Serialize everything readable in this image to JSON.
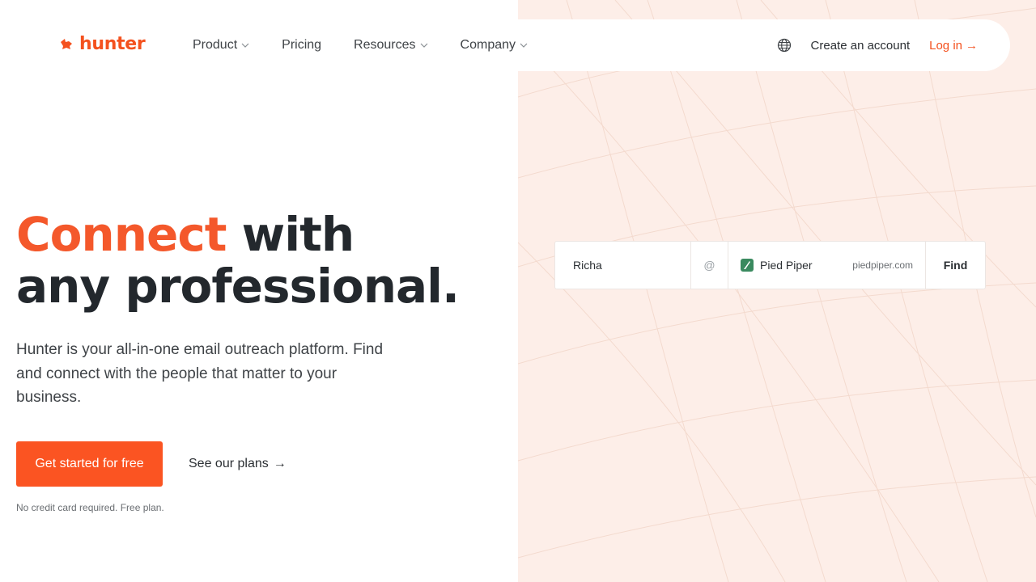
{
  "brand": {
    "name": "hunter",
    "accent_color": "#f4511e",
    "panel_color": "#fdeee8"
  },
  "nav": {
    "items": [
      {
        "label": "Product",
        "has_dropdown": true
      },
      {
        "label": "Pricing",
        "has_dropdown": false
      },
      {
        "label": "Resources",
        "has_dropdown": true
      },
      {
        "label": "Company",
        "has_dropdown": true
      }
    ],
    "language_icon": "globe-icon",
    "create_account": "Create an account",
    "login": "Log in",
    "login_arrow": "→"
  },
  "hero": {
    "headline_accent": "Connect",
    "headline_rest_1": " with",
    "headline_line_2": "any professional.",
    "description": "Hunter is your all-in-one email outreach platform. Find and connect with the people that matter to your business.",
    "cta_primary": "Get started for free",
    "cta_secondary": "See our plans",
    "cta_secondary_arrow": "→",
    "note": "No credit card required. Free plan."
  },
  "finder": {
    "name_value": "Richa",
    "at_symbol": "@",
    "company_name": "Pied Piper",
    "company_domain": "piedpiper.com",
    "find_label": "Find"
  }
}
